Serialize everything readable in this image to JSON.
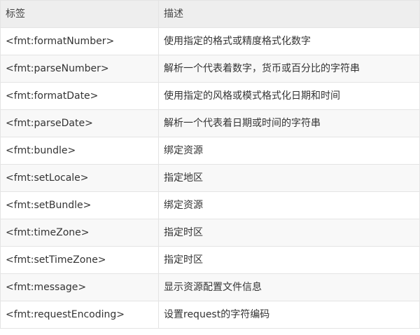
{
  "table": {
    "headers": [
      "标签",
      "描述"
    ],
    "rows": [
      {
        "tag": "<fmt:formatNumber>",
        "desc": "使用指定的格式或精度格式化数字"
      },
      {
        "tag": "<fmt:parseNumber>",
        "desc": "解析一个代表着数字，货币或百分比的字符串"
      },
      {
        "tag": "<fmt:formatDate>",
        "desc": "使用指定的风格或模式格式化日期和时间"
      },
      {
        "tag": "<fmt:parseDate>",
        "desc": "解析一个代表着日期或时间的字符串"
      },
      {
        "tag": "<fmt:bundle>",
        "desc": "绑定资源"
      },
      {
        "tag": "<fmt:setLocale>",
        "desc": "指定地区"
      },
      {
        "tag": "<fmt:setBundle>",
        "desc": "绑定资源"
      },
      {
        "tag": "<fmt:timeZone>",
        "desc": "指定时区"
      },
      {
        "tag": "<fmt:setTimeZone>",
        "desc": "指定时区"
      },
      {
        "tag": "<fmt:message>",
        "desc": "显示资源配置文件信息"
      },
      {
        "tag": "<fmt:requestEncoding>",
        "desc": "设置request的字符编码"
      }
    ]
  }
}
